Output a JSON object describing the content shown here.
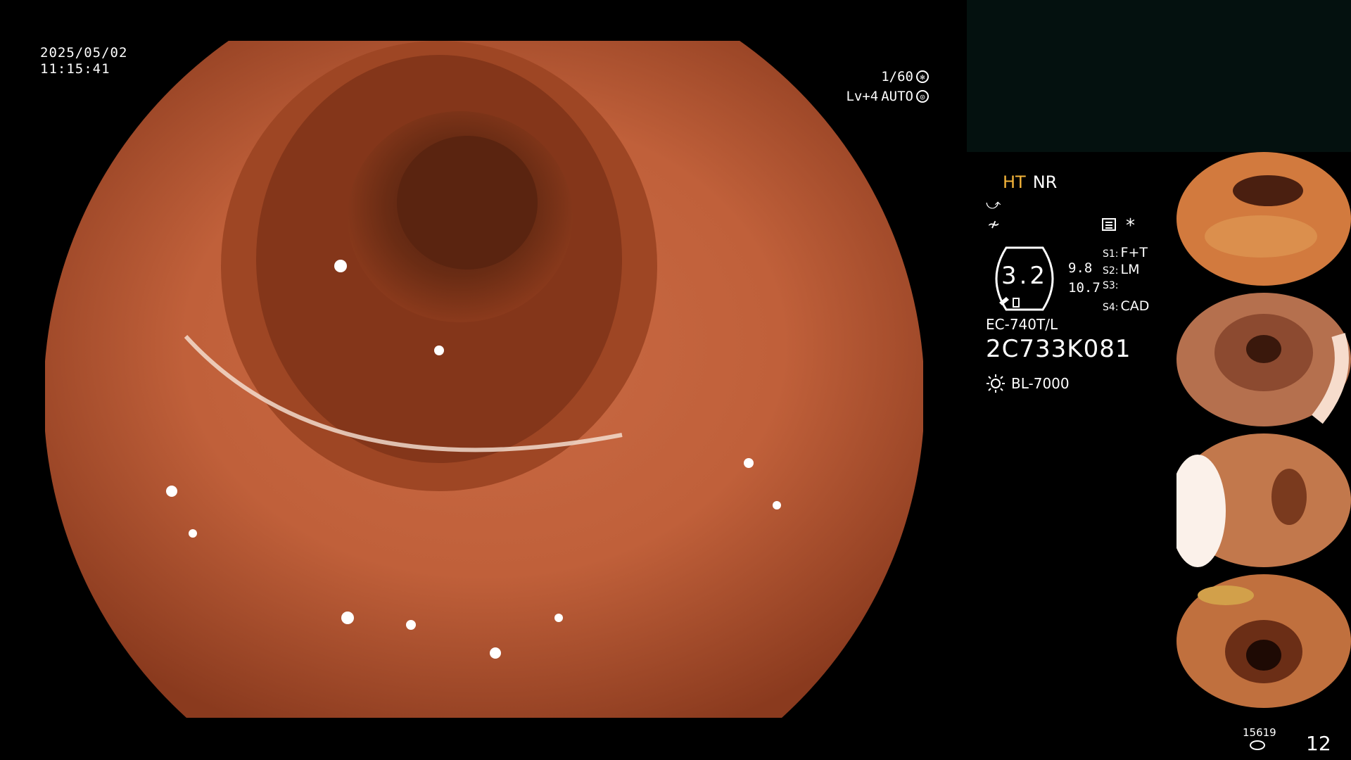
{
  "datetime": {
    "date": "2025/05/02",
    "time": "11:15:41"
  },
  "exposure": {
    "shutter": "1/60",
    "level": "Lv+4",
    "mode": "AUTO"
  },
  "image_mode": {
    "ht": "HT",
    "nr": "NR"
  },
  "zoom": {
    "value": "3.2",
    "val_a": "9.8",
    "val_b": "10.7"
  },
  "switches": [
    {
      "key": "S1:",
      "value": "F+T"
    },
    {
      "key": "S2:",
      "value": "LM"
    },
    {
      "key": "S3:",
      "value": ""
    },
    {
      "key": "S4:",
      "value": "CAD"
    }
  ],
  "scope": {
    "model": "EC-740T/L",
    "serial": "2C733K081",
    "light_source": "BL-7000"
  },
  "counters": {
    "small": "15619",
    "big": "12"
  },
  "icons": [
    "shutter-icon",
    "auto-exposure-icon",
    "menu-icon",
    "sun-icon",
    "disk-icon"
  ],
  "colors": {
    "ht_accent": "#f4b43a",
    "mucosa": "#c0603a",
    "panel_dark": "#04110f"
  }
}
